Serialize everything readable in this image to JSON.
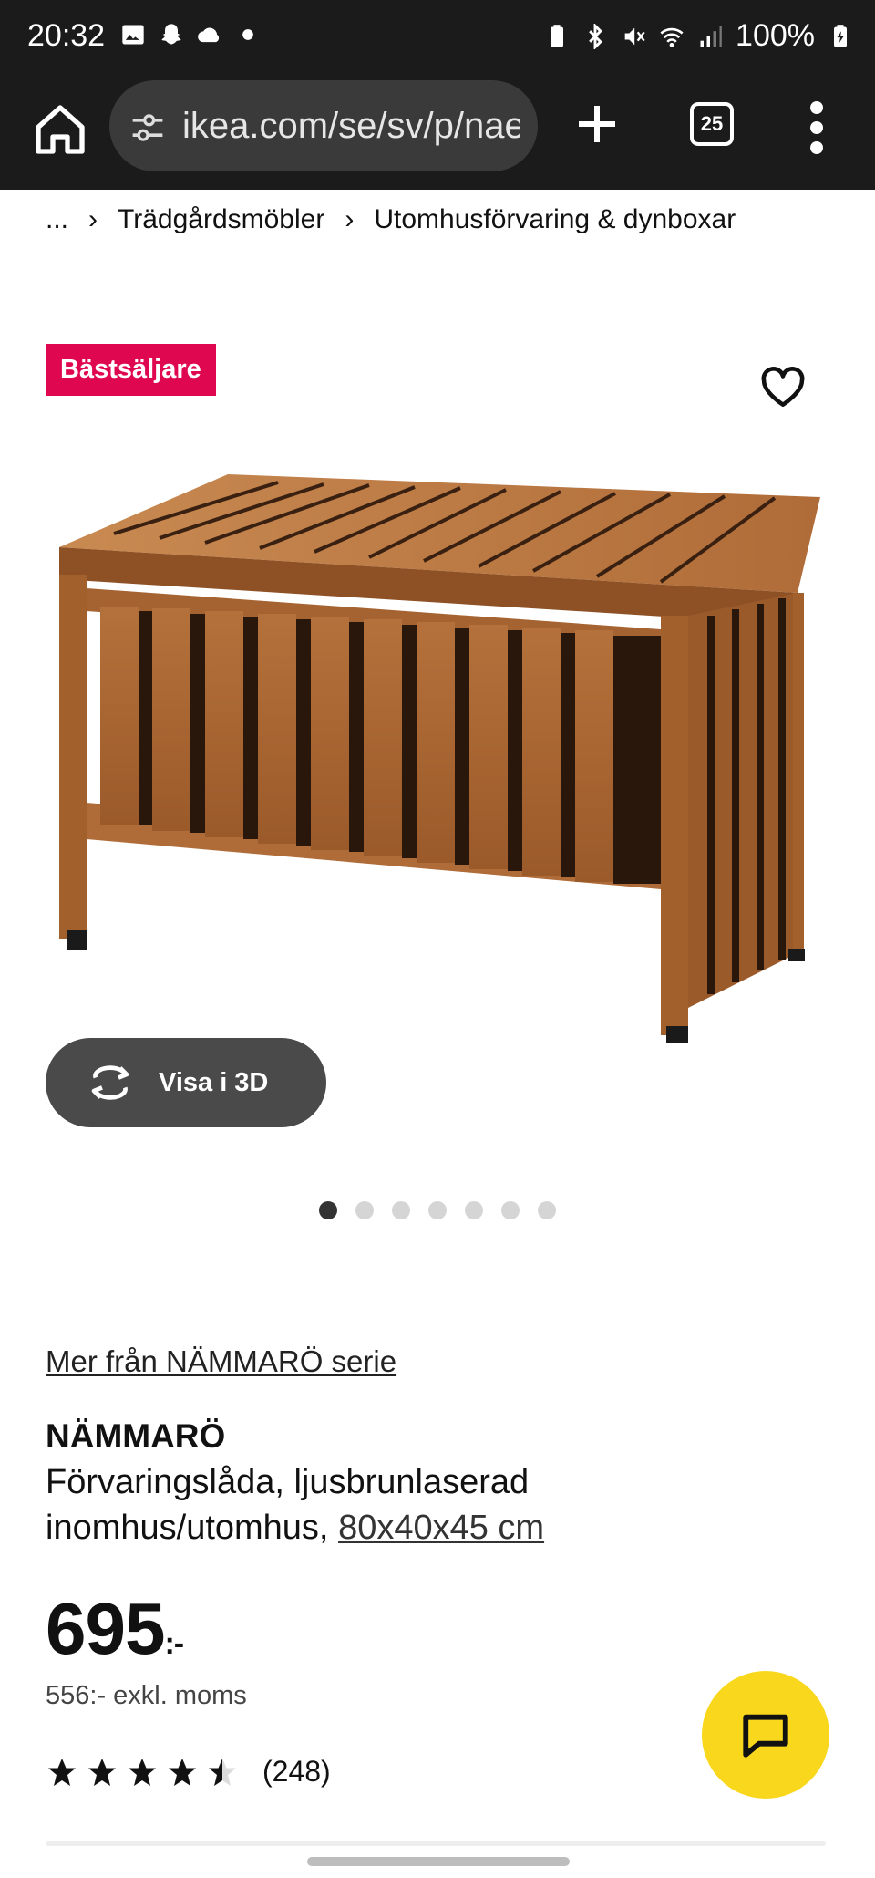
{
  "status_bar": {
    "time": "20:32",
    "battery": "100%"
  },
  "browser": {
    "url": "ikea.com/se/sv/p/nae",
    "tab_count": "25"
  },
  "breadcrumb": {
    "ellipsis": "...",
    "items": [
      "Trädgårdsmöbler",
      "Utomhusförvaring & dynboxar"
    ]
  },
  "badge": "Bästsäljare",
  "gallery": {
    "view_3d_label": "Visa i 3D",
    "total_images": 7,
    "active_index": 0
  },
  "product": {
    "series_link": "Mer från NÄMMARÖ serie",
    "name": "NÄMMARÖ",
    "description_line1": "Förvaringslåda, ljusbrunlaserad",
    "description_line2": "inomhus/utomhus, ",
    "size_link": "80x40x45 cm",
    "price": "695",
    "price_suffix": ":-",
    "price_ex_vat": "556:- exkl. moms",
    "rating_value": 4.5,
    "rating_count": "(248)"
  },
  "icons": {
    "home": "home-icon",
    "tune": "site-settings-icon",
    "plus": "new-tab-icon",
    "menu": "more-vert-icon",
    "heart": "heart-icon",
    "rotate": "rotate-3d-icon",
    "chat": "chat-icon"
  },
  "colors": {
    "badge": "#e00751",
    "chat": "#f9d71c",
    "chrome_bg": "#1b1b1b"
  }
}
